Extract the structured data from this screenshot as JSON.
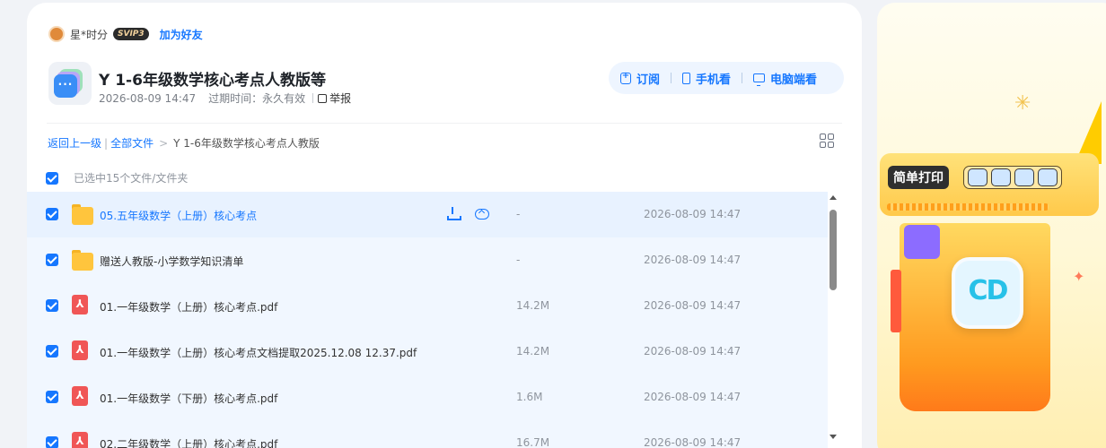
{
  "share": {
    "sharer_name": "星*时分",
    "vip_badge": "SVIP3",
    "add_friend": "加为好友",
    "title": "Y 1-6年级数学核心考点人教版等",
    "created": "2026-08-09 14:47",
    "expiry": "过期时间：永久有效",
    "report": "举报"
  },
  "actions": {
    "subscribe": "订阅",
    "mobile_view": "手机看",
    "pc_view": "电脑端看"
  },
  "breadcrumb": {
    "back": "返回上一级",
    "all_files": "全部文件",
    "current": "Y 1-6年级数学核心考点人教版"
  },
  "selection": {
    "text": "已选中15个文件/文件夹"
  },
  "files": [
    {
      "name": "05.五年级数学（上册）核心考点",
      "size": "-",
      "date": "2026-08-09 14:47"
    },
    {
      "name": "赠送人教版-小学数学知识清单",
      "size": "-",
      "date": "2026-08-09 14:47"
    },
    {
      "name": "01.一年级数学（上册）核心考点.pdf",
      "size": "14.2M",
      "date": "2026-08-09 14:47"
    },
    {
      "name": "01.一年级数学（上册）核心考点文档提取2025.12.08 12.37.pdf",
      "size": "14.2M",
      "date": "2026-08-09 14:47"
    },
    {
      "name": "01.一年级数学（下册）核心考点.pdf",
      "size": "1.6M",
      "date": "2026-08-09 14:47"
    },
    {
      "name": "02.二年级数学（上册）核心考点.pdf",
      "size": "16.7M",
      "date": "2026-08-09 14:47"
    }
  ],
  "ad": {
    "label": "简单打印",
    "logo": "CD"
  },
  "colors": {
    "accent": "#1677ff",
    "row_selected": "#f1f7ff",
    "folder": "#ffc53d",
    "pdf": "#f05656"
  },
  "icons": {
    "sharer_avatar": "avatar",
    "subscribe": "subscribe-icon",
    "mobile": "phone-icon",
    "pc": "monitor-icon",
    "report": "report-icon",
    "view_toggle": "grid-view-icon",
    "download": "download-icon",
    "save_to_cloud": "cloud-save-icon",
    "folder": "folder-icon",
    "pdf": "pdf-icon"
  }
}
